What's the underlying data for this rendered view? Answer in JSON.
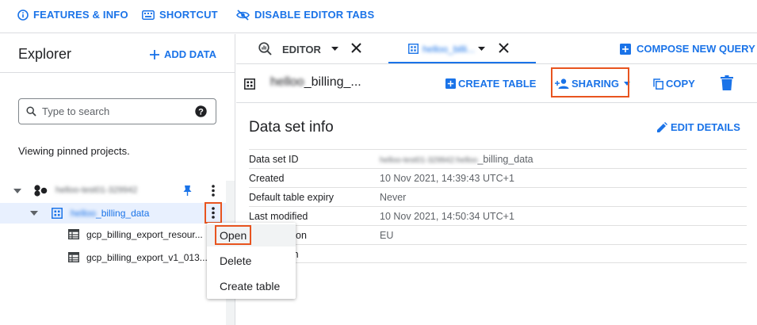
{
  "toolbar": {
    "features_label": "FEATURES & INFO",
    "shortcut_label": "SHORTCUT",
    "disable_tabs_label": "DISABLE EDITOR TABS"
  },
  "explorer": {
    "title": "Explorer",
    "add_data_label": "ADD DATA",
    "search_placeholder": "Type to search",
    "pinned_text": "Viewing pinned projects.",
    "tree": {
      "project_name": "helloo-test01-329942",
      "dataset_prefix_blurred": "helloo",
      "dataset_name": "_billing_data",
      "tables": [
        {
          "label": "gcp_billing_export_resour..."
        },
        {
          "label": "gcp_billing_export_v1_013..."
        }
      ]
    }
  },
  "context_menu": {
    "items": [
      {
        "label": "Open"
      },
      {
        "label": "Delete"
      },
      {
        "label": "Create table"
      }
    ]
  },
  "tabs": {
    "editor_label": "EDITOR",
    "dataset_tab_label": "helloo_billi...",
    "compose_label": "COMPOSE NEW QUERY"
  },
  "dataset_header": {
    "name_blurred": "helloo",
    "name": "_billing_...",
    "create_table_label": "CREATE TABLE",
    "sharing_label": "SHARING",
    "copy_label": "COPY"
  },
  "dataset_info": {
    "title": "Data set info",
    "edit_details_label": "EDIT DETAILS",
    "rows": [
      {
        "key": "Data set ID",
        "value_blurred": "helloo-test01-329942:helloo",
        "value": "_billing_data"
      },
      {
        "key": "Created",
        "value": "10 Nov 2021, 14:39:43 UTC+1"
      },
      {
        "key": "Default table expiry",
        "value": "Never"
      },
      {
        "key": "Last modified",
        "value": "10 Nov 2021, 14:50:34 UTC+1"
      },
      {
        "key": "Data location",
        "value": "EU"
      },
      {
        "key": "Description",
        "value": ""
      }
    ]
  },
  "colors": {
    "accent": "#1a73e8",
    "highlight": "#e8541f",
    "selected_row": "#e8f0fe"
  }
}
